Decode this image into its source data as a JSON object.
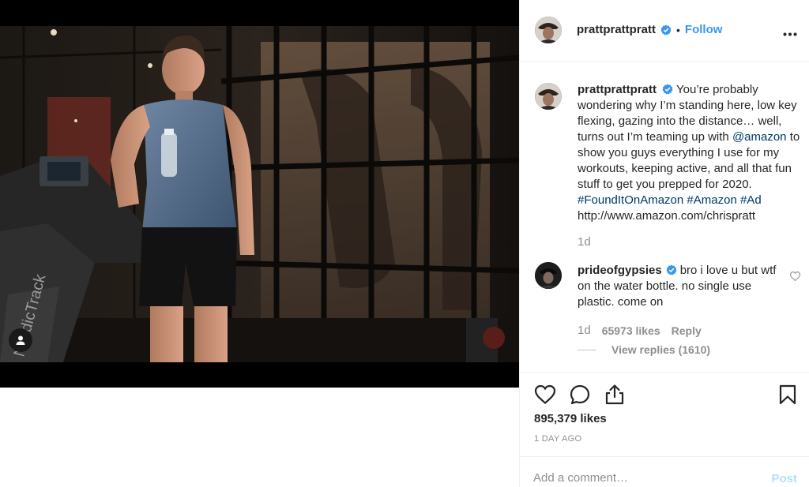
{
  "post": {
    "author": "prattprattpratt",
    "follow_label": "Follow",
    "more_icon": "more-horizontal-icon"
  },
  "caption": {
    "author": "prattprattpratt",
    "text_1": "You’re probably wondering why I’m standing here, low key flexing, gazing into the distance… well, turns out I’m teaming up with ",
    "mention": "@amazon",
    "text_2": " to show you guys everything I use for my workouts, keeping active, and all that fun stuff to get you prepped for 2020.",
    "tag_1": "#FoundItOnAmazon",
    "tag_2": "#Amazon",
    "tag_3": "#Ad",
    "url": "http://www.amazon.com/chrispratt",
    "time": "1d"
  },
  "comment": {
    "author": "prideofgypsies",
    "text": "bro i love u but wtf on the water bottle. no single use plastic. come on",
    "time": "1d",
    "likes": "65973 likes",
    "reply_label": "Reply",
    "view_replies": "View replies (1610)"
  },
  "stats": {
    "likes": "895,379 likes",
    "age": "1 DAY AGO"
  },
  "composer": {
    "placeholder": "Add a comment…",
    "post_label": "Post"
  },
  "colors": {
    "link": "#00376b",
    "follow": "#3897f0",
    "verified": "#3897f0",
    "muted": "#8e8e8e",
    "post_disabled": "#b2dffc"
  }
}
